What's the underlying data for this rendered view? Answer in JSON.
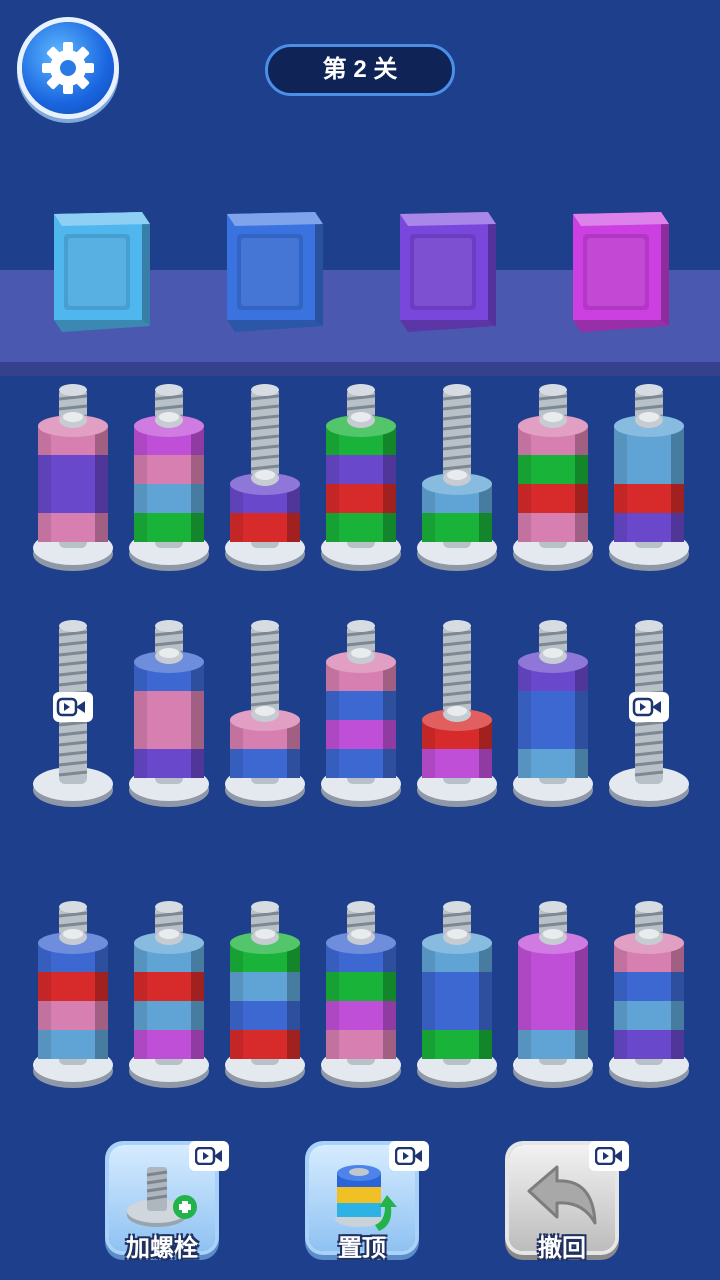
{
  "header": {
    "level_label": "第 2 关"
  },
  "boxes": [
    {
      "name": "box-light-blue",
      "color": "#4fb6ee"
    },
    {
      "name": "box-blue",
      "color": "#3a73e0"
    },
    {
      "name": "box-purple",
      "color": "#7a47dd"
    },
    {
      "name": "box-magenta",
      "color": "#cc3fe0"
    }
  ],
  "nut_colors": {
    "pink": "#d77fb0",
    "purple": "#6a48cc",
    "magenta": "#c04fd8",
    "lightblue": "#5fa4d4",
    "green": "#19b33a",
    "red": "#d72a2a",
    "blue": "#3d68d2"
  },
  "bolts": [
    {
      "row": 0,
      "col": 0,
      "nuts": [
        "pink",
        "purple",
        "purple",
        "pink"
      ]
    },
    {
      "row": 0,
      "col": 1,
      "nuts": [
        "green",
        "lightblue",
        "pink",
        "magenta"
      ]
    },
    {
      "row": 0,
      "col": 2,
      "nuts": [
        "red",
        "purple"
      ]
    },
    {
      "row": 0,
      "col": 3,
      "nuts": [
        "green",
        "red",
        "purple",
        "green"
      ]
    },
    {
      "row": 0,
      "col": 4,
      "nuts": [
        "green",
        "lightblue"
      ]
    },
    {
      "row": 0,
      "col": 5,
      "nuts": [
        "pink",
        "red",
        "green",
        "pink"
      ]
    },
    {
      "row": 0,
      "col": 6,
      "nuts": [
        "purple",
        "red",
        "lightblue",
        "lightblue"
      ]
    },
    {
      "row": 1,
      "col": 0,
      "nuts": [],
      "locked": true
    },
    {
      "row": 1,
      "col": 1,
      "nuts": [
        "purple",
        "pink",
        "pink",
        "blue"
      ]
    },
    {
      "row": 1,
      "col": 2,
      "nuts": [
        "blue",
        "pink"
      ]
    },
    {
      "row": 1,
      "col": 3,
      "nuts": [
        "blue",
        "magenta",
        "blue",
        "pink"
      ]
    },
    {
      "row": 1,
      "col": 4,
      "nuts": [
        "magenta",
        "red"
      ]
    },
    {
      "row": 1,
      "col": 5,
      "nuts": [
        "lightblue",
        "blue",
        "blue",
        "purple"
      ]
    },
    {
      "row": 1,
      "col": 6,
      "nuts": [],
      "locked": true
    },
    {
      "row": 2,
      "col": 0,
      "nuts": [
        "lightblue",
        "pink",
        "red",
        "blue"
      ]
    },
    {
      "row": 2,
      "col": 1,
      "nuts": [
        "magenta",
        "lightblue",
        "red",
        "lightblue"
      ]
    },
    {
      "row": 2,
      "col": 2,
      "nuts": [
        "red",
        "blue",
        "lightblue",
        "green"
      ]
    },
    {
      "row": 2,
      "col": 3,
      "nuts": [
        "pink",
        "magenta",
        "green",
        "blue"
      ]
    },
    {
      "row": 2,
      "col": 4,
      "nuts": [
        "green",
        "blue",
        "blue",
        "lightblue"
      ]
    },
    {
      "row": 2,
      "col": 5,
      "nuts": [
        "lightblue",
        "magenta",
        "magenta",
        "magenta"
      ]
    },
    {
      "row": 2,
      "col": 6,
      "nuts": [
        "purple",
        "lightblue",
        "blue",
        "pink"
      ]
    }
  ],
  "toolbar": {
    "add_bolt_label": "加螺栓",
    "pin_top_label": "置顶",
    "undo_label": "撤回"
  }
}
